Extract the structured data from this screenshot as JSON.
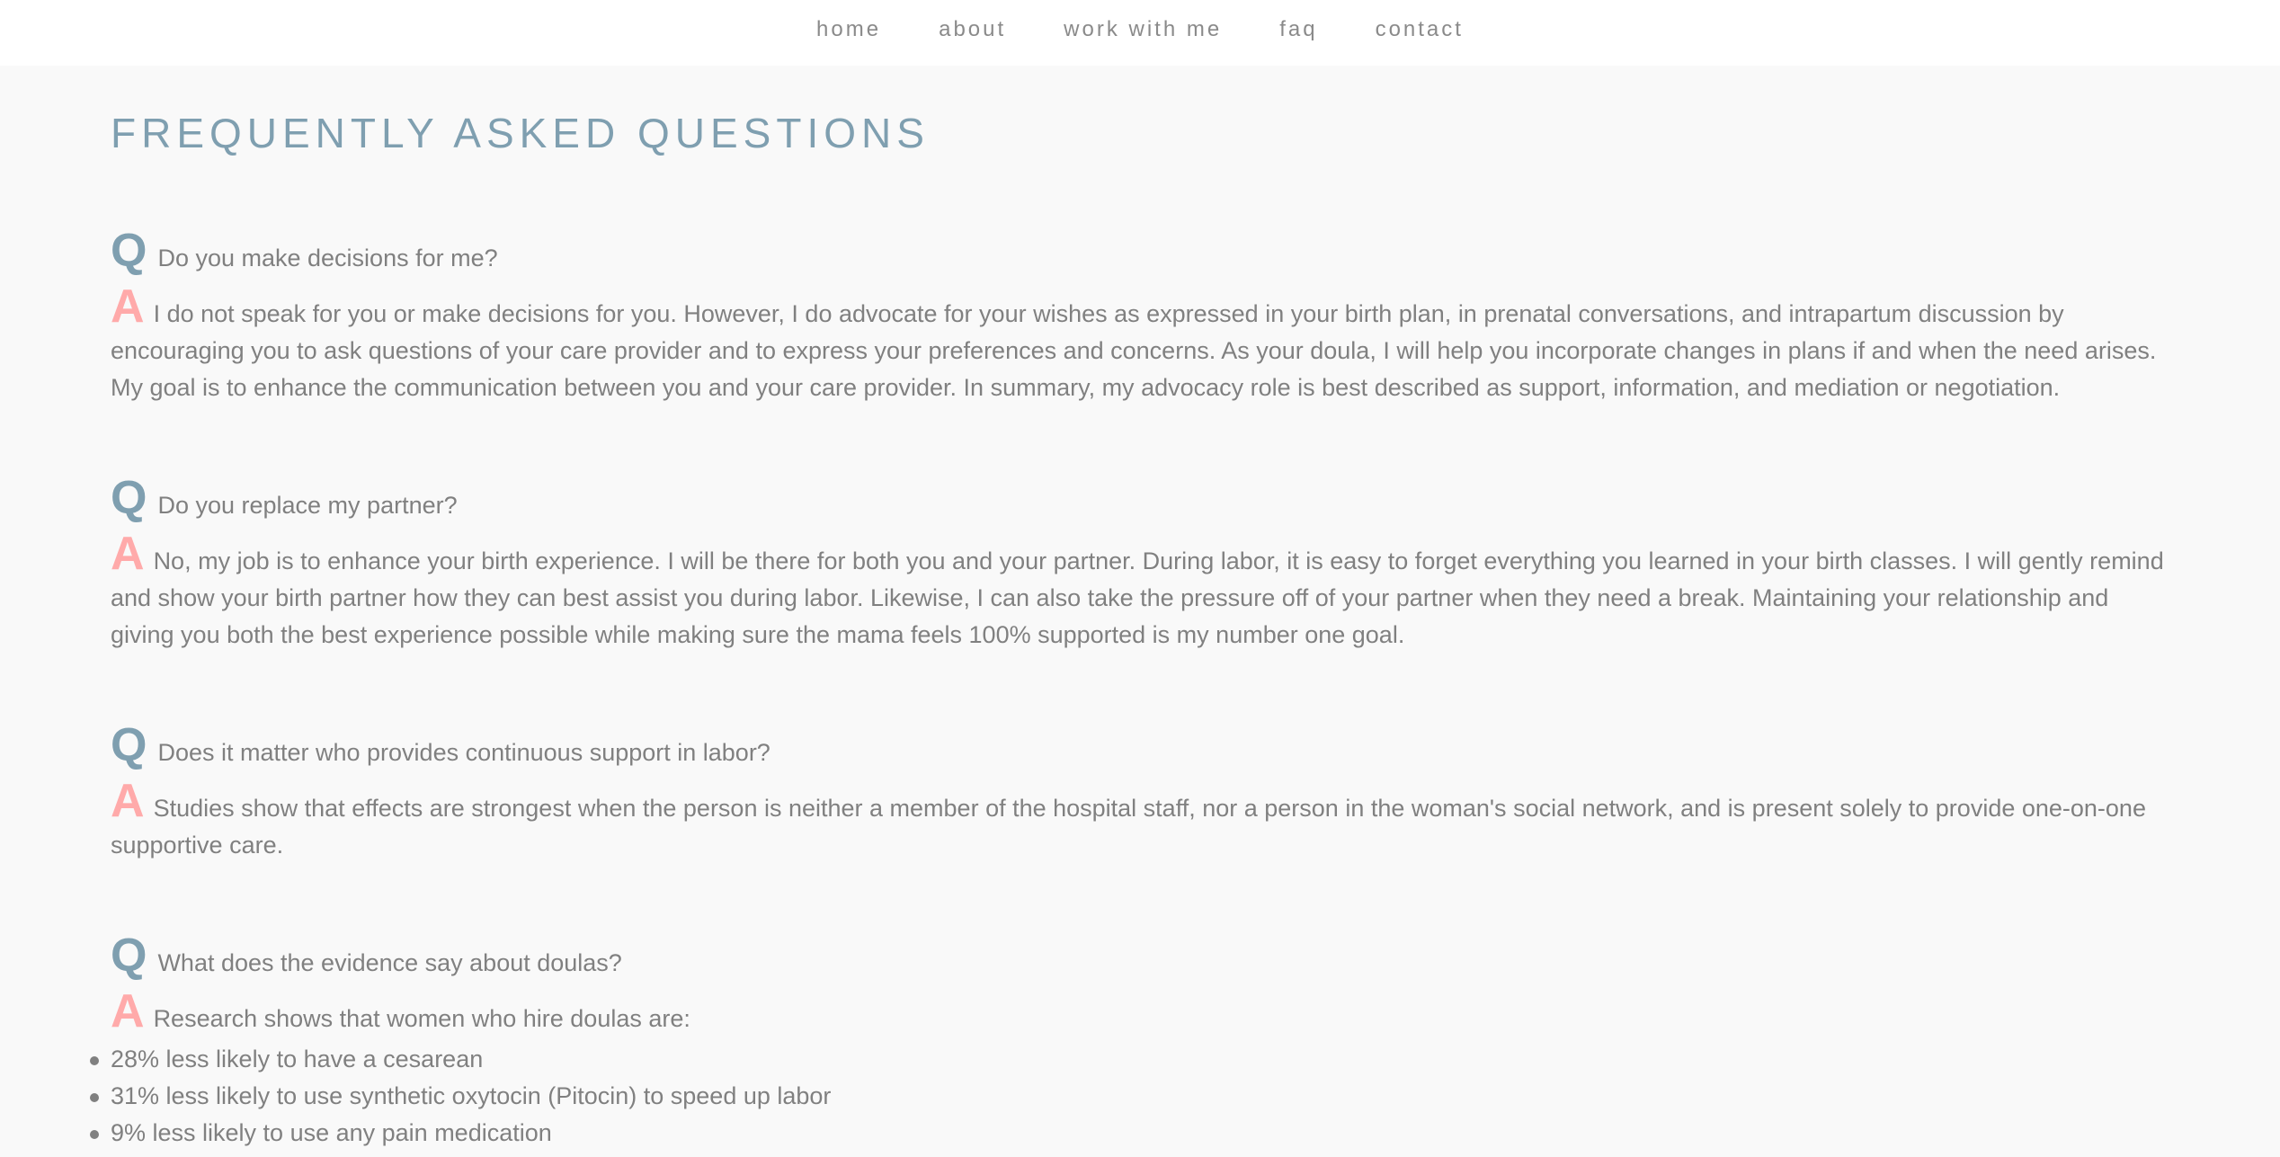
{
  "nav": {
    "items": [
      "home",
      "about",
      "work with me",
      "faq",
      "contact"
    ]
  },
  "page_title": "FREQUENTLY ASKED QUESTIONS",
  "q_marker": "Q",
  "a_marker": "A",
  "faqs": [
    {
      "question": "Do you make decisions for me?",
      "answer": "I do not speak for you or make decisions for you. However, I do advocate for your wishes as expressed in your birth plan, in prenatal conversations, and intrapartum discussion by encouraging you to ask questions of your care provider and to express your preferences and concerns. As your doula, I will help you incorporate changes in plans if and when the need arises. My goal is to enhance the communication between you and your care provider. In summary, my advocacy role is best described as support, information, and mediation or negotiation."
    },
    {
      "question": "Do you replace my partner?",
      "answer": "No, my job is to enhance your birth experience. I will be there for both you and your partner. During labor, it is easy to forget everything you learned in your birth classes. I will gently remind and show your birth partner how they can best assist you during labor. Likewise, I can also take the pressure off of your partner when they need a break. Maintaining your relationship and giving you both the best experience possible while making sure the mama feels 100% supported is my number one goal."
    },
    {
      "question": "Does it matter who provides continuous support in labor?",
      "answer": "Studies show that effects are strongest when the person is neither a member of the hospital staff, nor a person in the woman's social network, and is present solely to provide one-on-one supportive care."
    },
    {
      "question": "What does the evidence say about doulas?",
      "answer": "Research shows that women who hire doulas are:",
      "bullets": [
        "28% less likely to have a cesarean",
        "31% less likely to use synthetic oxytocin (Pitocin) to speed up labor",
        "9% less likely to use any pain medication"
      ]
    }
  ],
  "colors": {
    "accent_q": "#7f9fb0",
    "accent_a": "#ffaaaa",
    "text": "#808080",
    "background": "#f9f9f9"
  }
}
